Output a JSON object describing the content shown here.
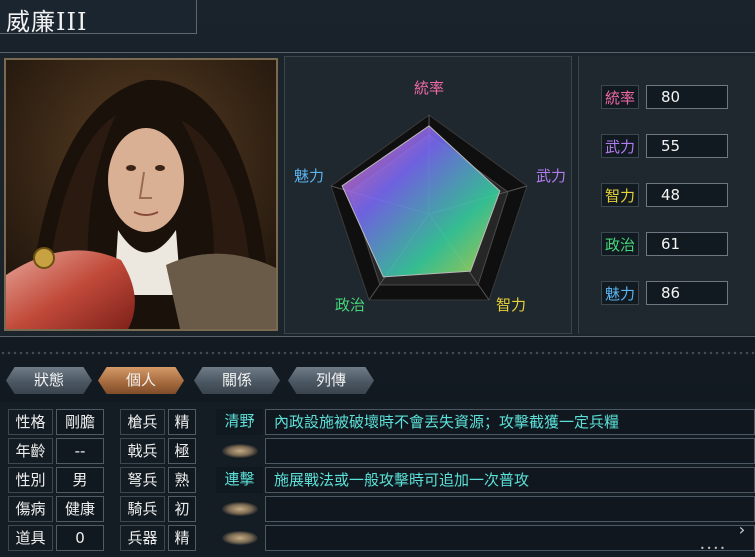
{
  "character": {
    "name": "威廉III"
  },
  "radar": {
    "labels": {
      "leadership": "統率",
      "war": "武力",
      "intelligence": "智力",
      "politics": "政治",
      "charisma": "魅力"
    },
    "colors": {
      "leadership": "#f06aa6",
      "war": "#b07cf0",
      "intelligence": "#e8d23a",
      "politics": "#46d67a",
      "charisma": "#5ab4f0"
    }
  },
  "stats": [
    {
      "label": "統率",
      "value": "80",
      "color": "#f06aa6"
    },
    {
      "label": "武力",
      "value": "55",
      "color": "#b07cf0"
    },
    {
      "label": "智力",
      "value": "48",
      "color": "#e8d23a"
    },
    {
      "label": "政治",
      "value": "61",
      "color": "#46d67a"
    },
    {
      "label": "魅力",
      "value": "86",
      "color": "#5ab4f0"
    }
  ],
  "tabs": [
    "狀態",
    "個人",
    "關係",
    "列傳"
  ],
  "active_tab": "個人",
  "profile": [
    {
      "label": "性格",
      "value": "剛膽"
    },
    {
      "label": "年齡",
      "value": "--"
    },
    {
      "label": "性別",
      "value": "男"
    },
    {
      "label": "傷病",
      "value": "健康"
    },
    {
      "label": "道具",
      "value": "0"
    }
  ],
  "aptitudes": [
    {
      "label": "槍兵",
      "value": "精"
    },
    {
      "label": "戟兵",
      "value": "極"
    },
    {
      "label": "弩兵",
      "value": "熟"
    },
    {
      "label": "騎兵",
      "value": "初"
    },
    {
      "label": "兵器",
      "value": "精"
    }
  ],
  "skills": [
    {
      "name": "清野",
      "desc": "內政設施被破壞時不會丟失資源；攻擊截獲一定兵糧"
    },
    {
      "name": "",
      "desc": ""
    },
    {
      "name": "連擊",
      "desc": "施展戰法或一般攻擊時可追加一次普攻"
    },
    {
      "name": "",
      "desc": ""
    },
    {
      "name": "",
      "desc": ""
    }
  ],
  "scroll": {
    "arrow": "›",
    "dots": "••••"
  }
}
